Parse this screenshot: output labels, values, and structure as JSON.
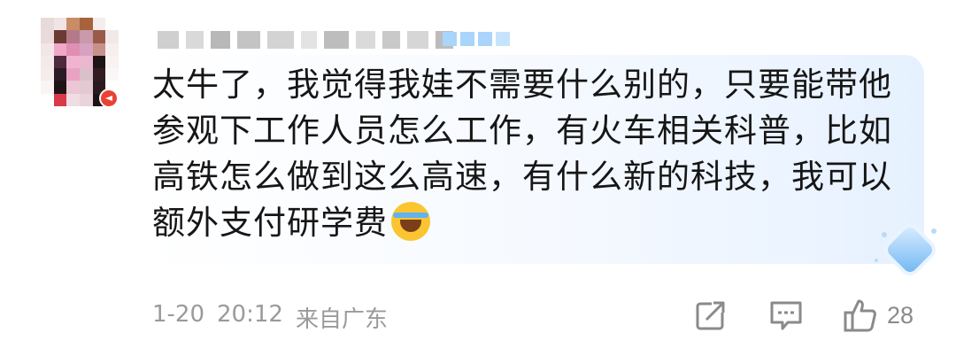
{
  "comment": {
    "text": "太牛了，我觉得我娃不需要什么别的，只要能带他参观下工作人员怎么工作，有火车相关科普，比如高铁怎么做到这么高速，有什么新的科技，我可以额外支付研学费",
    "emoji": "laughing-crying-emoji"
  },
  "meta": {
    "date": "1-20",
    "time": "20:12",
    "location": "来自广东"
  },
  "actions": {
    "share_icon": "share-icon",
    "reply_icon": "reply-icon",
    "like_icon": "thumbs-up-icon",
    "like_count": "28"
  },
  "colors": {
    "text": "#161616",
    "meta": "#9a9a9a",
    "bubble_accent": "#e6f1ff"
  }
}
